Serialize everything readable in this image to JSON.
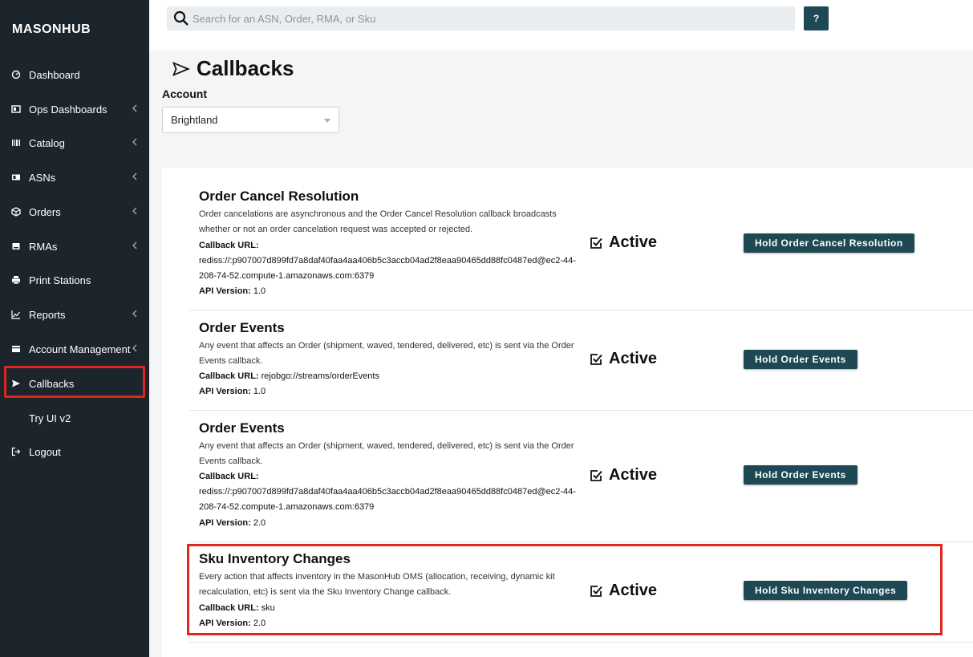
{
  "app": {
    "logo": "MASONHUB"
  },
  "sidebar": {
    "items": [
      {
        "label": "Dashboard",
        "icon": "gauge-icon"
      },
      {
        "label": "Ops Dashboards",
        "icon": "dashboards-icon"
      },
      {
        "label": "Catalog",
        "icon": "barcode-icon"
      },
      {
        "label": "ASNs",
        "icon": "id-card-icon"
      },
      {
        "label": "Orders",
        "icon": "cube-icon"
      },
      {
        "label": "RMAs",
        "icon": "box-icon"
      },
      {
        "label": "Print Stations",
        "icon": "printer-icon"
      },
      {
        "label": "Reports",
        "icon": "line-chart-icon"
      },
      {
        "label": "Account Management",
        "icon": "account-icon"
      },
      {
        "label": "Callbacks",
        "icon": "send-icon"
      },
      {
        "label": "Try UI v2",
        "icon": ""
      },
      {
        "label": "Logout",
        "icon": "logout-icon"
      }
    ]
  },
  "search": {
    "placeholder": "Search for an ASN, Order, RMA, or Sku"
  },
  "help": {
    "label": "?"
  },
  "page": {
    "title": "Callbacks"
  },
  "account": {
    "label": "Account",
    "selected": "Brightland"
  },
  "callbacks": [
    {
      "title": "Order Cancel Resolution",
      "description": "Order cancelations are asynchronous and the Order Cancel Resolution callback broadcasts whether or not an order cancelation request was accepted or rejected.",
      "url_label": "Callback URL:",
      "url": "rediss://:p907007d899fd7a8daf40faa4aa406b5c3accb04ad2f8eaa90465dd88fc0487ed@ec2-44-208-74-52.compute-1.amazonaws.com:6379",
      "version_label": "API Version:",
      "version": "1.0",
      "status": "Active",
      "button": "Hold Order Cancel Resolution"
    },
    {
      "title": "Order Events",
      "description": "Any event that affects an Order (shipment, waved, tendered, delivered, etc) is sent via the Order Events callback.",
      "url_label": "Callback URL:",
      "url": "rejobgo://streams/orderEvents",
      "version_label": "API Version:",
      "version": "1.0",
      "status": "Active",
      "button": "Hold Order Events"
    },
    {
      "title": "Order Events",
      "description": "Any event that affects an Order (shipment, waved, tendered, delivered, etc) is sent via the Order Events callback.",
      "url_label": "Callback URL:",
      "url": "rediss://:p907007d899fd7a8daf40faa4aa406b5c3accb04ad2f8eaa90465dd88fc0487ed@ec2-44-208-74-52.compute-1.amazonaws.com:6379",
      "version_label": "API Version:",
      "version": "2.0",
      "status": "Active",
      "button": "Hold Order Events"
    },
    {
      "title": "Sku Inventory Changes",
      "description": "Every action that affects inventory in the MasonHub OMS (allocation, receiving, dynamic kit recalculation, etc) is sent via the Sku Inventory Change callback.",
      "url_label": "Callback URL:",
      "url": "sku",
      "version_label": "API Version:",
      "version": "2.0",
      "status": "Active",
      "button": "Hold Sku Inventory Changes"
    }
  ],
  "colors": {
    "sidebar_bg": "#1c252b",
    "button_bg": "#1e4854",
    "highlight": "#e0261a"
  }
}
